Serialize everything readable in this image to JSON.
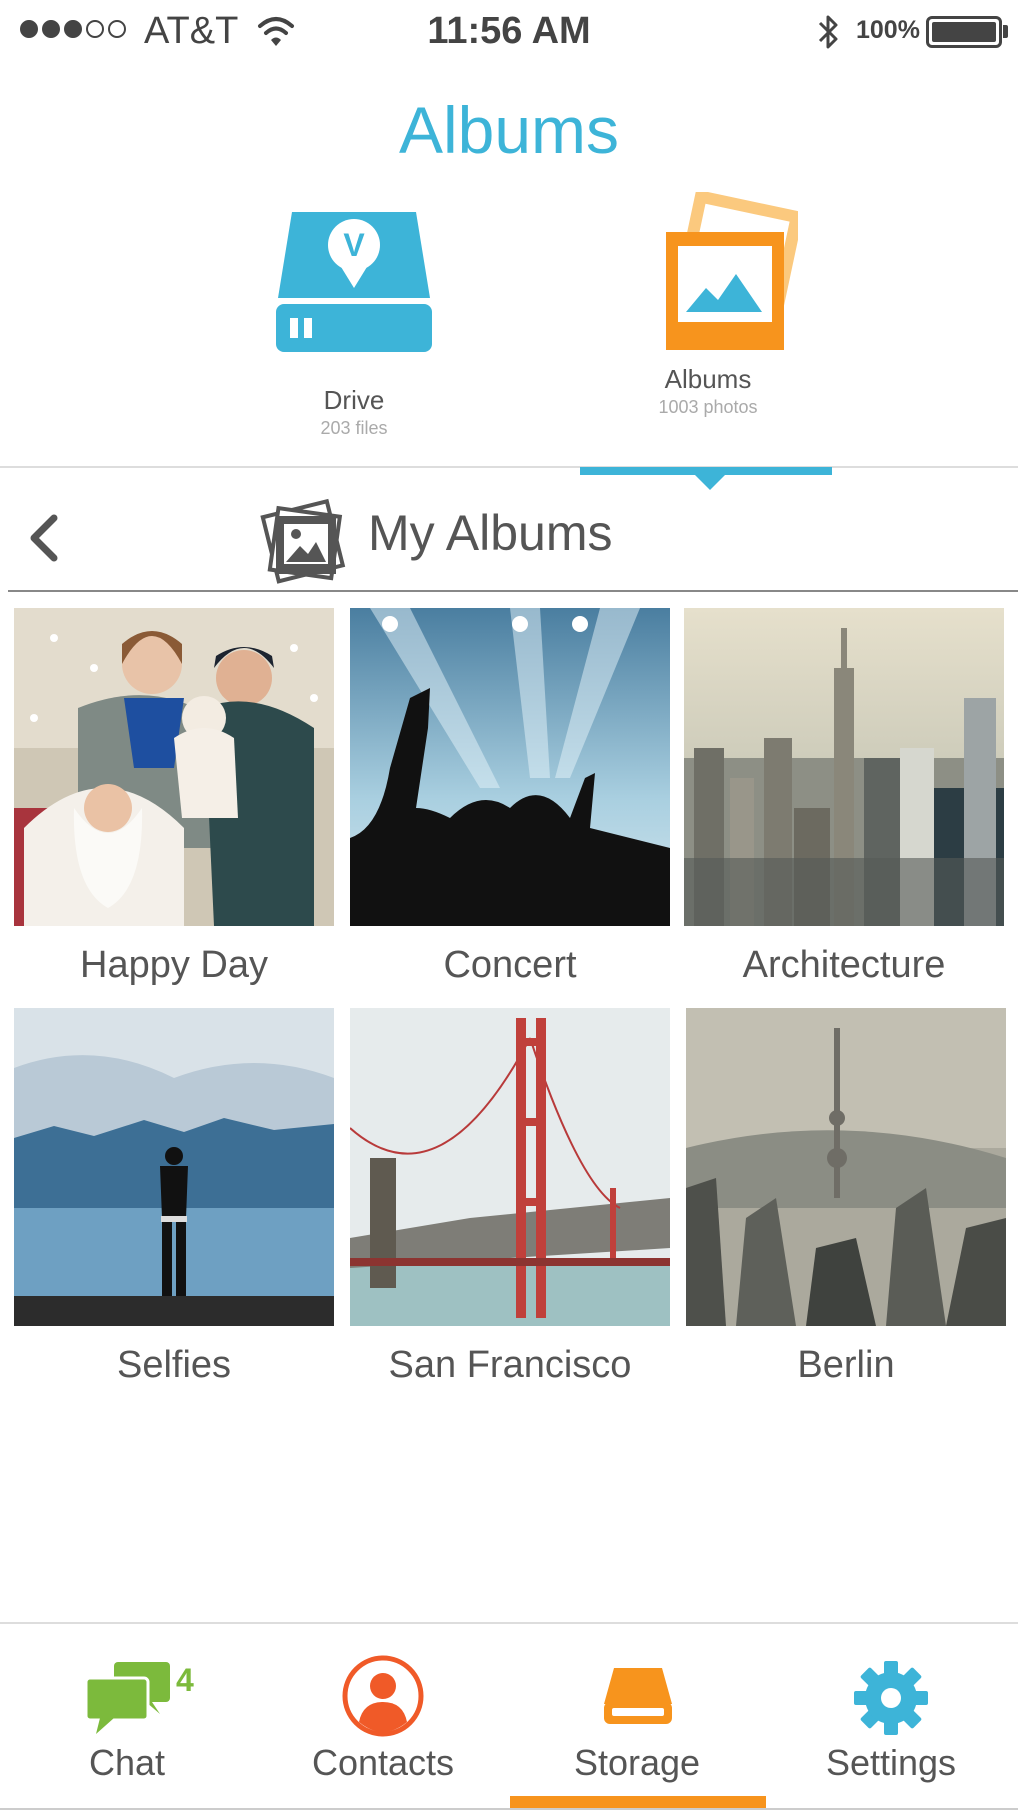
{
  "status_bar": {
    "carrier": "AT&T",
    "time": "11:56 AM",
    "battery_percent": "100%",
    "signal_bars_filled": 3,
    "signal_bars_total": 5
  },
  "header": {
    "title": "Albums"
  },
  "storage_switcher": {
    "drive": {
      "label": "Drive",
      "count": "203 files",
      "icon": "drive-icon",
      "color": "#3db4d8"
    },
    "albums": {
      "label": "Albums",
      "count": "1003 photos",
      "icon": "photo-albums-icon",
      "color": "#f7941d",
      "active": true
    }
  },
  "section": {
    "title": "My Albums",
    "icon": "albums-stack-icon"
  },
  "albums": [
    {
      "name": "Happy Day"
    },
    {
      "name": "Concert"
    },
    {
      "name": "Architecture"
    },
    {
      "name": "Selfies"
    },
    {
      "name": "San Francisco"
    },
    {
      "name": "Berlin"
    }
  ],
  "tab_bar": {
    "tabs": [
      {
        "label": "Chat",
        "icon": "chat-icon",
        "badge": "4",
        "color": "#7cba3c"
      },
      {
        "label": "Contacts",
        "icon": "contacts-icon",
        "color": "#f05a28"
      },
      {
        "label": "Storage",
        "icon": "storage-icon",
        "color": "#f7941d",
        "active": true
      },
      {
        "label": "Settings",
        "icon": "gear-icon",
        "color": "#3db4d8"
      }
    ]
  },
  "colors": {
    "accent_blue": "#3db4d8",
    "accent_orange": "#f7941d",
    "accent_green": "#7cba3c",
    "accent_red": "#f05a28"
  }
}
